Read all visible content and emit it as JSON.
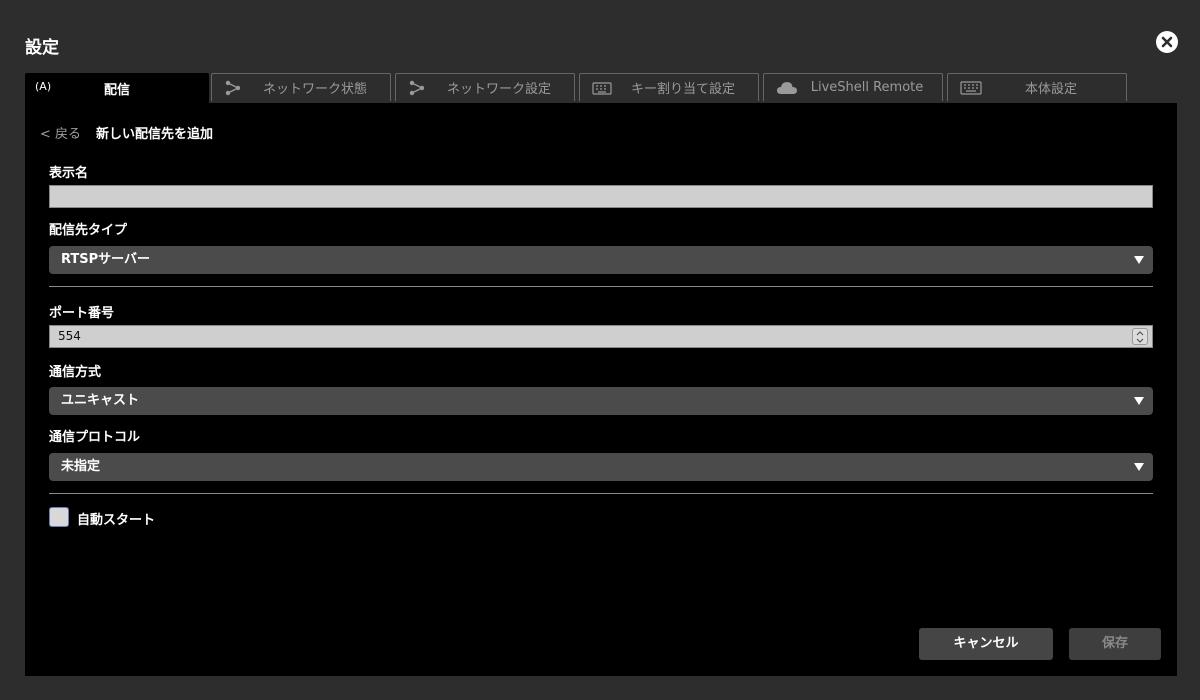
{
  "window": {
    "title": "設定"
  },
  "tabs": [
    {
      "label": "配信",
      "icon": "broadcast-icon",
      "icon_text": "(A)",
      "active": true
    },
    {
      "label": "ネットワーク状態",
      "icon": "network-status-icon",
      "active": false
    },
    {
      "label": "ネットワーク設定",
      "icon": "network-settings-icon",
      "active": false
    },
    {
      "label": "キー割り当て設定",
      "icon": "keyboard-icon",
      "active": false
    },
    {
      "label": "LiveShell Remote",
      "icon": "cloud-icon",
      "active": false
    },
    {
      "label": "本体設定",
      "icon": "device-keyboard-icon",
      "active": false
    }
  ],
  "header": {
    "back_label": "< 戻る",
    "page_title": "新しい配信先を追加"
  },
  "form": {
    "display_name": {
      "label": "表示名",
      "value": ""
    },
    "destination_type": {
      "label": "配信先タイプ",
      "value": "RTSPサーバー"
    },
    "port": {
      "label": "ポート番号",
      "value": "554"
    },
    "method": {
      "label": "通信方式",
      "value": "ユニキャスト"
    },
    "protocol": {
      "label": "通信プロトコル",
      "value": "未指定"
    },
    "auto_start": {
      "label": "自動スタート",
      "checked": false
    }
  },
  "actions": {
    "cancel_label": "キャンセル",
    "save_label": "保存"
  },
  "colors": {
    "background": "#2d2d2d",
    "panel": "#000000",
    "select": "#4b4b4b",
    "input": "#cfcfcf"
  }
}
